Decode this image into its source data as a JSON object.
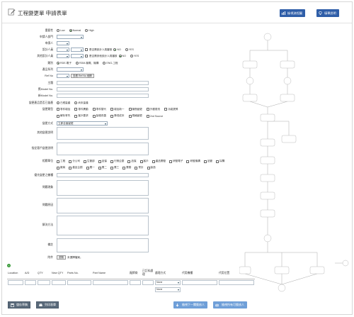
{
  "header": {
    "title": "工程變更單  申請表單",
    "btn_flowchart": "檢視流程圖",
    "btn_help": "填單說明"
  },
  "form": {
    "importance": {
      "label": "重要性",
      "options": [
        "Low",
        "Normal",
        "High"
      ],
      "selected": "Normal"
    },
    "dept": {
      "label": "申請人部門"
    },
    "applicant": {
      "label": "申請人"
    },
    "designer": {
      "label": "設計人員",
      "same_label": "是否需設計人員審核",
      "options": [
        "NO",
        "YES"
      ],
      "selected": "NO"
    },
    "reviewer": {
      "label": "其他設計人員",
      "same_label": "是否需其他設計人員審核",
      "options": [
        "NO",
        "YES"
      ],
      "selected": "NO"
    },
    "category": {
      "label": "類別",
      "options": [
        "RDE-電子",
        "RDM-機電、機構",
        "ENG-工程"
      ],
      "selected": "RDE-電子"
    },
    "series": {
      "label": "產品系列"
    },
    "ref_no": {
      "label": "Ref No",
      "button": "查看 Ref No 細節"
    },
    "subject": {
      "label": "主題"
    },
    "old_model": {
      "label": "舊Model No."
    },
    "new_model": {
      "label": "新Model No."
    },
    "bom_change": {
      "label": "變更產品是否已量產",
      "options": [
        "已經量產",
        "尚未量產"
      ]
    },
    "change_types": {
      "label": "變更類型",
      "options": [
        "零件增加",
        "零件異動",
        "零件替代",
        "增加新一",
        "機殼變更",
        "外觀更改",
        "功能提昇",
        "解析會失",
        "客戶要求",
        "製程改善",
        "降低成本",
        "規格變更",
        "2nd Source"
      ]
    },
    "change_method": {
      "label": "變更方式",
      "selected": "立即全面變更"
    },
    "other_change": {
      "label": "其他變更說明"
    },
    "ecr": {
      "label": "指定客戶變更說明"
    },
    "units": {
      "label": "相關單位",
      "options": [
        "工程",
        "分公司",
        "生管部",
        "品保",
        "行銷企劃",
        "品保",
        "客戶",
        "產品開發",
        "研發電子",
        "研發機構",
        "品管",
        "採購",
        "廠商",
        "產品企劃",
        "業一",
        "業二",
        "業三",
        "業務",
        "會計",
        "製造"
      ]
    },
    "priority": {
      "label": "優先變更之機種"
    },
    "issue": {
      "label": "問題現象"
    },
    "cause": {
      "label": "問題原因"
    },
    "solution": {
      "label": "解決方法"
    },
    "note": {
      "label": "備註"
    },
    "attachment": {
      "label": "附件",
      "button": "瀏覽",
      "status": "未選擇檔案。"
    }
  },
  "parts_table": {
    "add_label": "+",
    "columns": [
      "Location",
      "A/D",
      "QTY",
      "New QTY",
      "Parts No.",
      "Part Name",
      "廠牌商",
      "已訂料處理",
      "處理方式",
      "代用機種",
      "代用位置"
    ],
    "rows": [
      {
        "method": "None"
      },
      {
        "method": "None"
      }
    ]
  },
  "footer": {
    "save_draft": "儲存草稿",
    "print": "列印表單",
    "next_sign": "檢視下一關簽核人",
    "preview_sign": "檢視所有可簽核人"
  },
  "flow_nodes": [
    "開始",
    "申請人",
    "主管",
    "設計",
    "其他",
    "工程",
    "品保",
    "核准",
    "結案"
  ],
  "colors": {
    "accent": "#2f5ea8",
    "light_accent": "#6f9fd8",
    "check": "#3a9a3a"
  }
}
